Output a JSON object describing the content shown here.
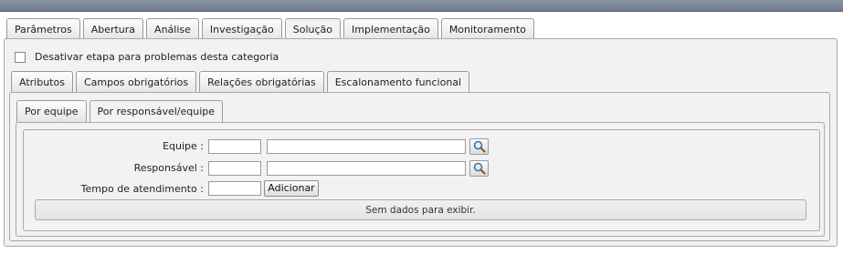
{
  "main_tabs": [
    "Parâmetros",
    "Abertura",
    "Análise",
    "Investigação",
    "Solução",
    "Implementação",
    "Monitoramento"
  ],
  "main_tabs_active": "Solução",
  "disable_step": {
    "label": "Desativar etapa para problemas desta categoria",
    "checked": false
  },
  "sub_tabs": [
    "Atributos",
    "Campos obrigatórios",
    "Relações obrigatórias",
    "Escalonamento funcional"
  ],
  "sub_tabs_active": "Escalonamento funcional",
  "inner_tabs": [
    "Por equipe",
    "Por responsável/equipe"
  ],
  "inner_tabs_active": "Por responsável/equipe",
  "form": {
    "team_label": "Equipe :",
    "team_code": "",
    "team_name": "",
    "responsible_label": "Responsável :",
    "responsible_code": "",
    "responsible_name": "",
    "time_label": "Tempo de atendimento :",
    "time_value": "",
    "add_label": "Adicionar"
  },
  "empty_message": "Sem dados para exibir.",
  "icons": {
    "lookup": "magnifier-icon"
  }
}
